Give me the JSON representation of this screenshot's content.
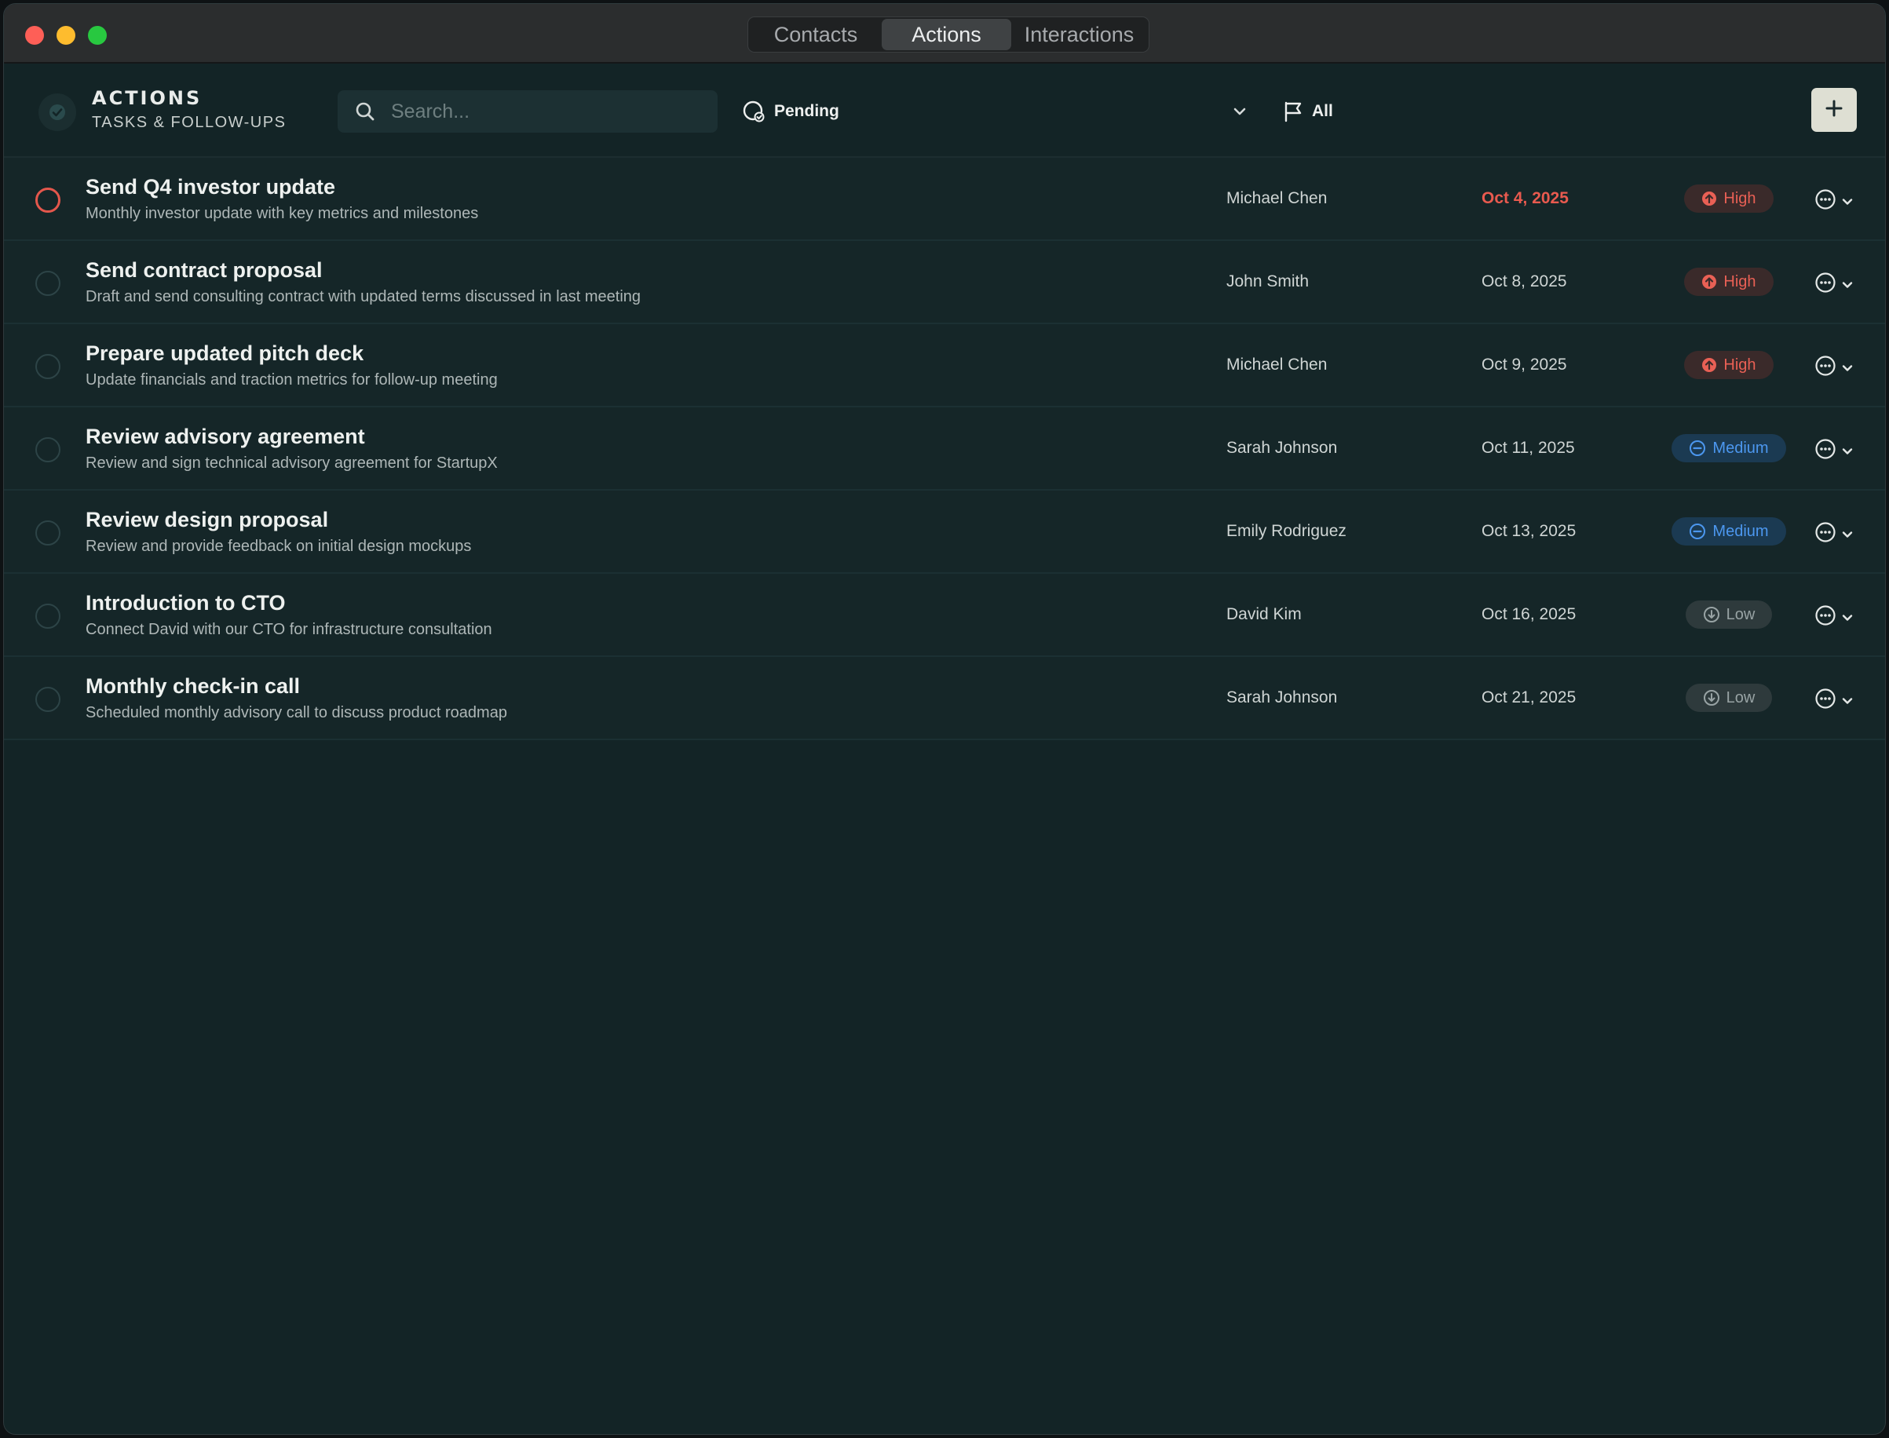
{
  "window": {
    "tabs": [
      {
        "label": "Contacts"
      },
      {
        "label": "Actions"
      },
      {
        "label": "Interactions"
      }
    ],
    "active_tab": "Actions"
  },
  "header": {
    "title": "ACTIONS",
    "subtitle": "TASKS & FOLLOW-UPS",
    "search_placeholder": "Search...",
    "status_filter": "Pending",
    "priority_filter": "All",
    "add_label": "+"
  },
  "colors": {
    "high": "#e96055",
    "medium": "#4c97ef",
    "low": "#98a3a4",
    "overdue": "#e95a4f"
  },
  "actions": [
    {
      "title": "Send Q4 investor update",
      "description": "Monthly investor update with key metrics and milestones",
      "contact": "Michael Chen",
      "due": "Oct 4, 2025",
      "priority": "High",
      "overdue": true
    },
    {
      "title": "Send contract proposal",
      "description": "Draft and send consulting contract with updated terms discussed in last meeting",
      "contact": "John Smith",
      "due": "Oct 8, 2025",
      "priority": "High",
      "overdue": false
    },
    {
      "title": "Prepare updated pitch deck",
      "description": "Update financials and traction metrics for follow-up meeting",
      "contact": "Michael Chen",
      "due": "Oct 9, 2025",
      "priority": "High",
      "overdue": false
    },
    {
      "title": "Review advisory agreement",
      "description": "Review and sign technical advisory agreement for StartupX",
      "contact": "Sarah Johnson",
      "due": "Oct 11, 2025",
      "priority": "Medium",
      "overdue": false
    },
    {
      "title": "Review design proposal",
      "description": "Review and provide feedback on initial design mockups",
      "contact": "Emily Rodriguez",
      "due": "Oct 13, 2025",
      "priority": "Medium",
      "overdue": false
    },
    {
      "title": "Introduction to CTO",
      "description": "Connect David with our CTO for infrastructure consultation",
      "contact": "David Kim",
      "due": "Oct 16, 2025",
      "priority": "Low",
      "overdue": false
    },
    {
      "title": "Monthly check-in call",
      "description": "Scheduled monthly advisory call to discuss product roadmap",
      "contact": "Sarah Johnson",
      "due": "Oct 21, 2025",
      "priority": "Low",
      "overdue": false
    }
  ]
}
